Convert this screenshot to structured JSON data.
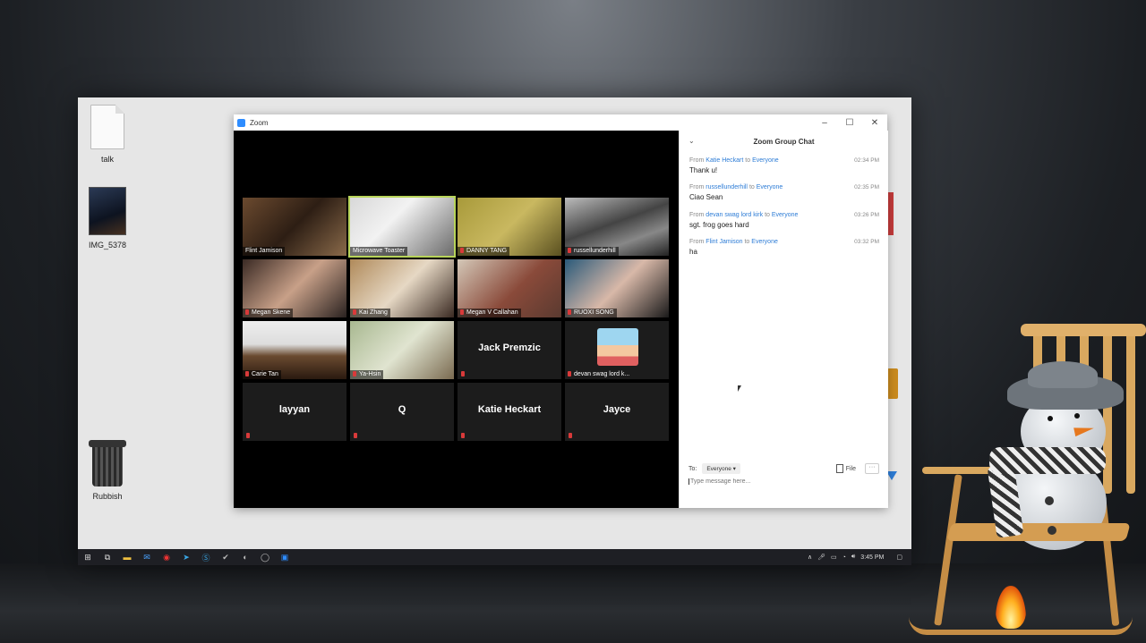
{
  "desktop": {
    "icons": [
      {
        "label": "talk"
      },
      {
        "label": "IMG_5378"
      },
      {
        "label": "Rubbish"
      }
    ]
  },
  "zoom_window": {
    "title": "Zoom",
    "controls": {
      "minimize": "–",
      "maximize": "☐",
      "close": "✕"
    }
  },
  "participants": [
    {
      "name": "Flint Jamison",
      "type": "video"
    },
    {
      "name": "Microwave Toaster",
      "type": "video",
      "active": true
    },
    {
      "name": "DANNY TANG",
      "type": "video"
    },
    {
      "name": "russellunderhill",
      "type": "video"
    },
    {
      "name": "Megan Skene",
      "type": "video"
    },
    {
      "name": "Kai Zhang",
      "type": "video"
    },
    {
      "name": "Megan V Callahan",
      "type": "video"
    },
    {
      "name": "RUOXI SONG",
      "type": "video"
    },
    {
      "name": "Carie Tan",
      "type": "video"
    },
    {
      "name": "Ya-Hsin",
      "type": "video"
    },
    {
      "name": "Jack Premzic",
      "type": "name"
    },
    {
      "name": "devan swag lord k...",
      "type": "video"
    },
    {
      "name": "layyan",
      "type": "name"
    },
    {
      "name": "Q",
      "type": "name"
    },
    {
      "name": "Katie Heckart",
      "type": "name"
    },
    {
      "name": "Jayce",
      "type": "name"
    }
  ],
  "chat": {
    "title": "Zoom Group Chat",
    "collapse_icon": "chevron-down",
    "messages": [
      {
        "from_label": "From",
        "sender": "Katie Heckart",
        "to_label": "to",
        "recipient": "Everyone",
        "time": "02:34 PM",
        "text": "Thank u!"
      },
      {
        "from_label": "From",
        "sender": "russellunderhill",
        "to_label": "to",
        "recipient": "Everyone",
        "time": "02:35 PM",
        "text": "Ciao Sean"
      },
      {
        "from_label": "From",
        "sender": "devan swag lord kirk",
        "to_label": "to",
        "recipient": "Everyone",
        "time": "03:26 PM",
        "text": "sgt. frog goes hard"
      },
      {
        "from_label": "From",
        "sender": "Flint Jamison",
        "to_label": "to",
        "recipient": "Everyone",
        "time": "03:32 PM",
        "text": "ha"
      }
    ],
    "to_label": "To:",
    "to_value": "Everyone",
    "file_label": "File",
    "more_label": "···",
    "input_placeholder": "Type message here..."
  },
  "taskbar": {
    "time": "3:45 PM"
  },
  "colors": {
    "zoom_blue": "#2d8cff",
    "active_speaker": "#b8d45a",
    "muted_red": "#d93a3a",
    "link_blue": "#2d7cd6"
  }
}
